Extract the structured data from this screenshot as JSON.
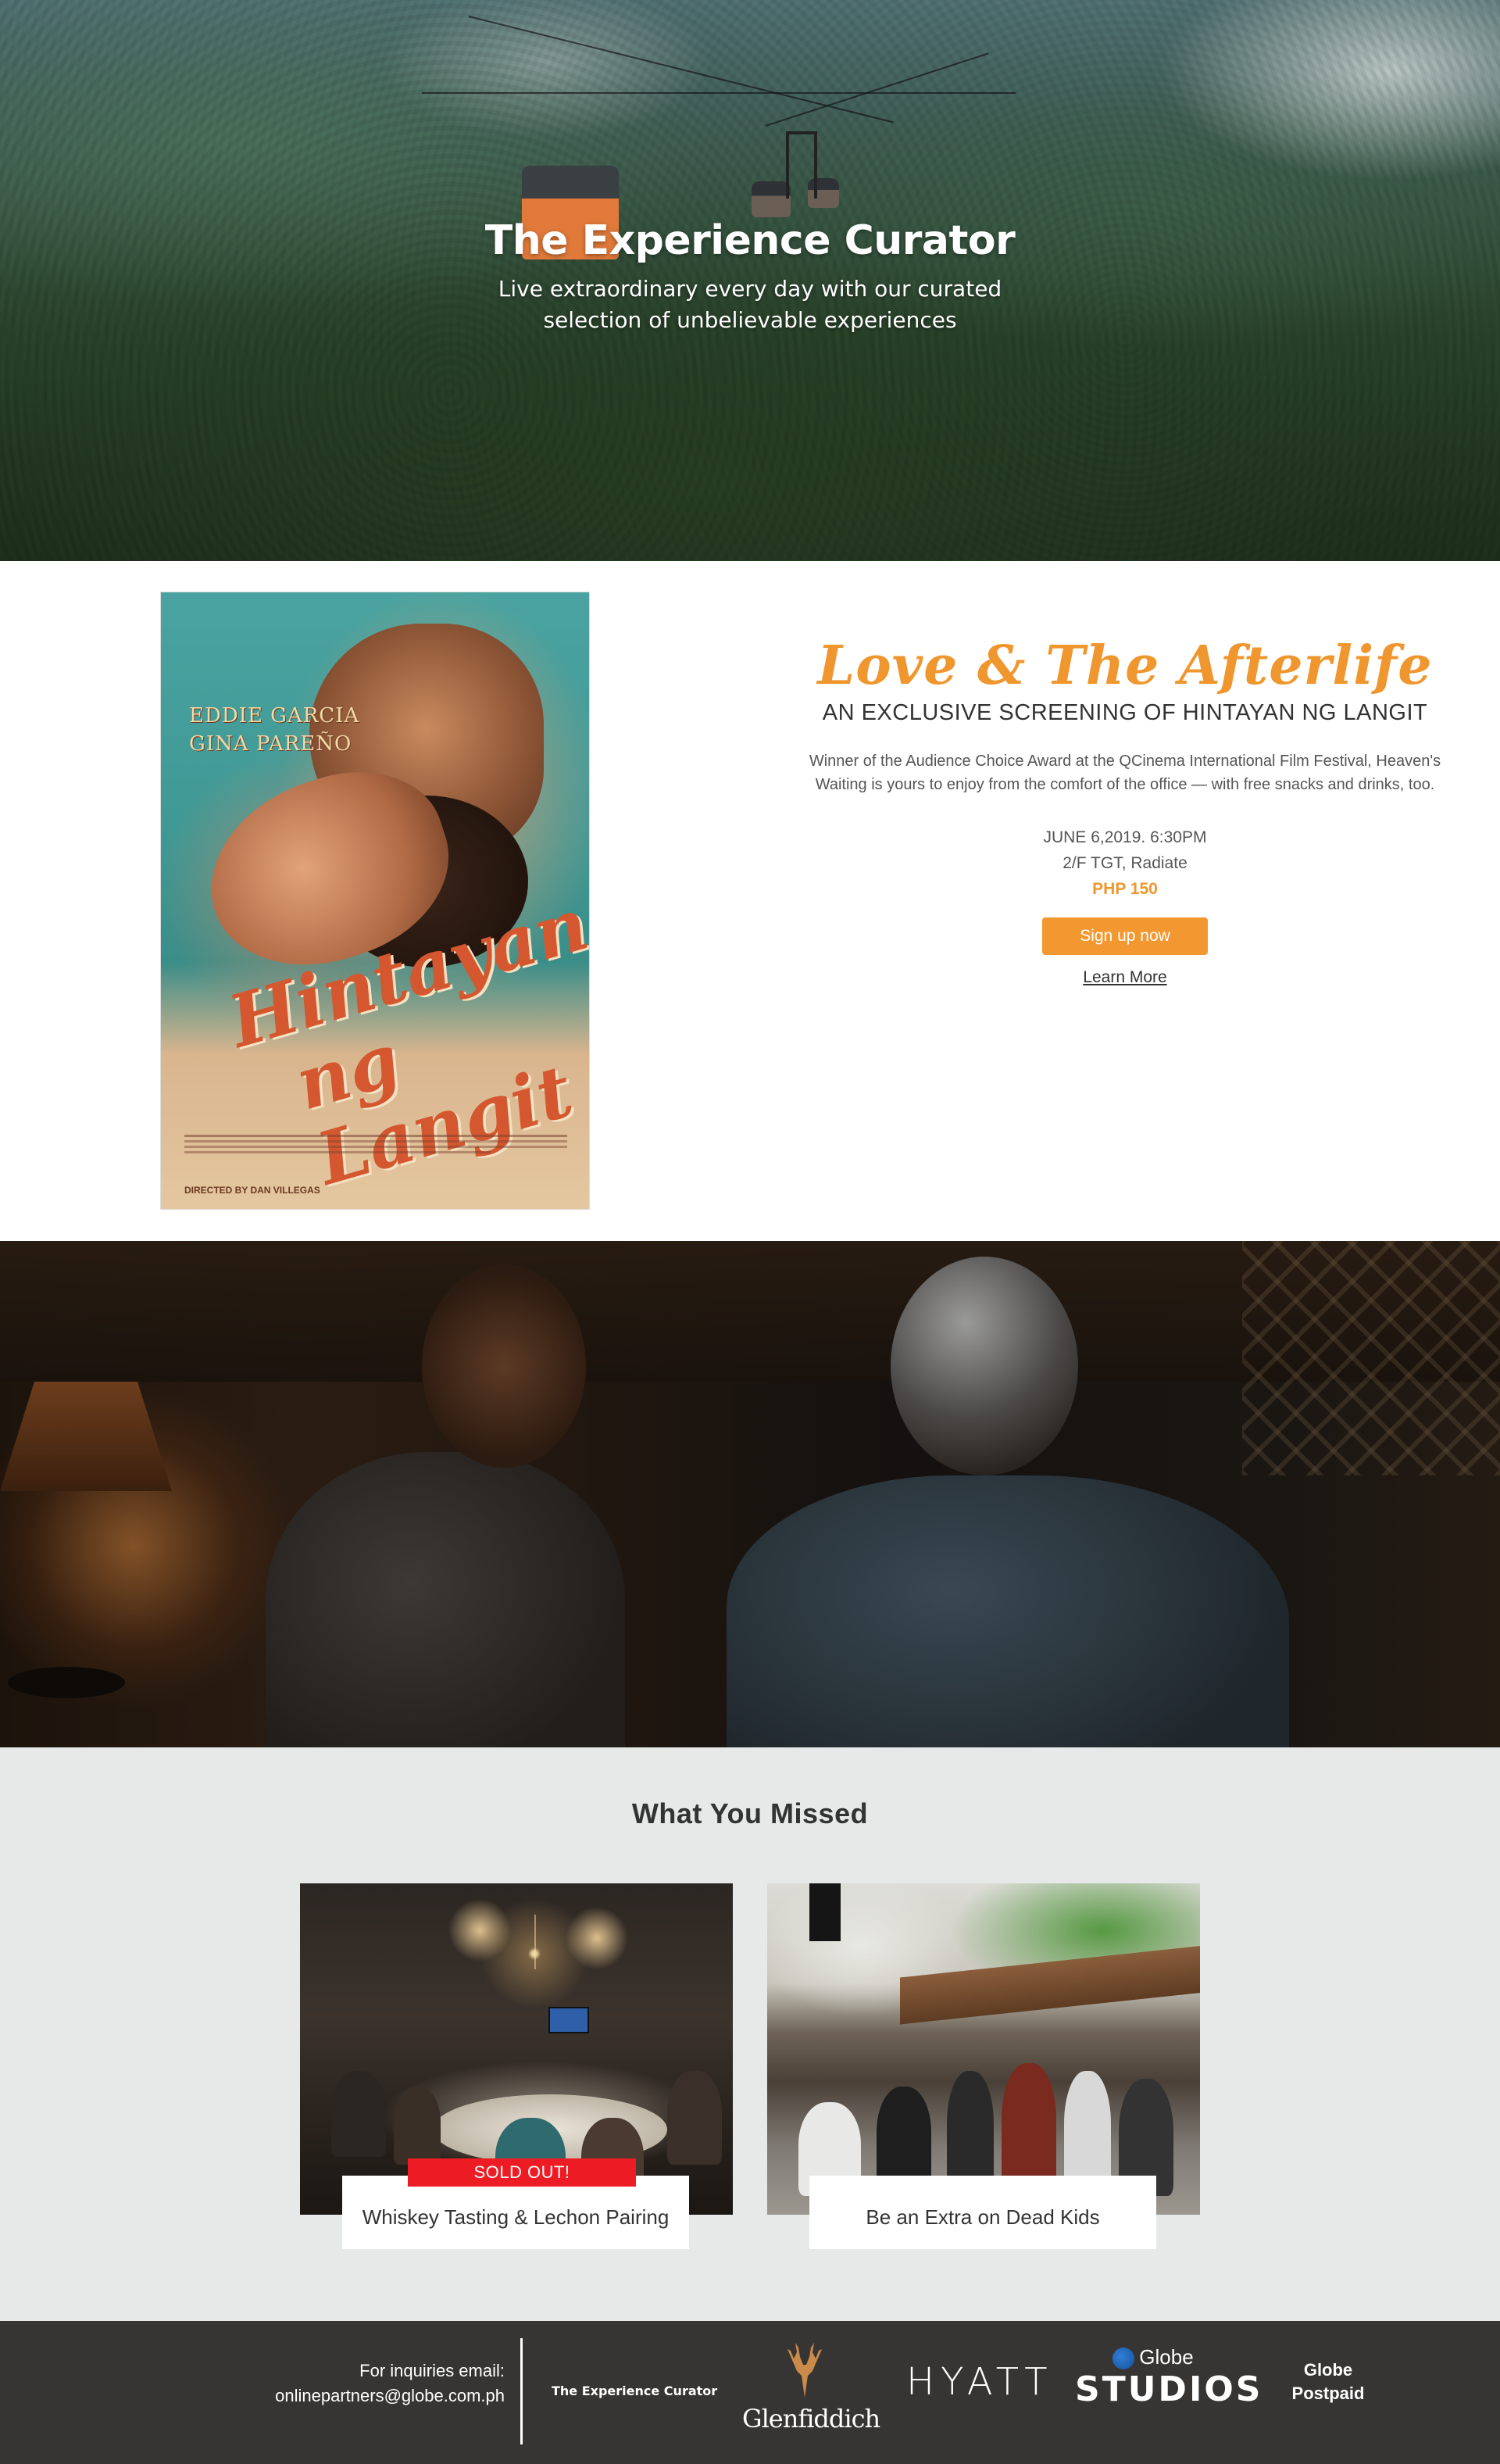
{
  "hero": {
    "title": "The Experience Curator",
    "subtitle_line1": "Live extraordinary every day with our curated",
    "subtitle_line2": "selection of unbelievable experiences"
  },
  "event": {
    "poster": {
      "cast_line1": "EDDIE GARCIA",
      "cast_line2": "GINA PAREÑO",
      "title_line1": "Hintayan",
      "title_line2": "ng Langit",
      "director": "DIRECTED BY DAN VILLEGAS"
    },
    "title": "Love & The Afterlife",
    "subtitle": "AN EXCLUSIVE SCREENING OF HINTAYAN NG LANGIT",
    "description": "Winner of the Audience Choice Award at the QCinema International Film Festival, Heaven's Waiting is yours to enjoy from the comfort of the office — with free snacks and drinks, too.",
    "date": "JUNE 6,2019. 6:30PM",
    "venue": "2/F TGT, Radiate",
    "price": "PHP 150",
    "signup_label": "Sign up now",
    "learn_more_label": "Learn More",
    "accent_color": "#f39830"
  },
  "missed": {
    "heading": "What You Missed",
    "cards": [
      {
        "title": "Whiskey Tasting & Lechon Pairing",
        "badge": "SOLD OUT!"
      },
      {
        "title": "Be an Extra on Dead Kids"
      }
    ],
    "badge_color": "#ed1c24"
  },
  "footer": {
    "inquiry_line1": "For inquiries email:",
    "inquiry_line2": "onlinepartners@globe.com.ph",
    "logos": {
      "experience_curator": "The Experience Curator",
      "glenfiddich": "Glenfiddich",
      "hyatt": "HYATT",
      "globe": "Globe",
      "studios": "STUDIOS",
      "globe_postpaid_line1": "Globe",
      "globe_postpaid_line2": "Postpaid"
    }
  }
}
